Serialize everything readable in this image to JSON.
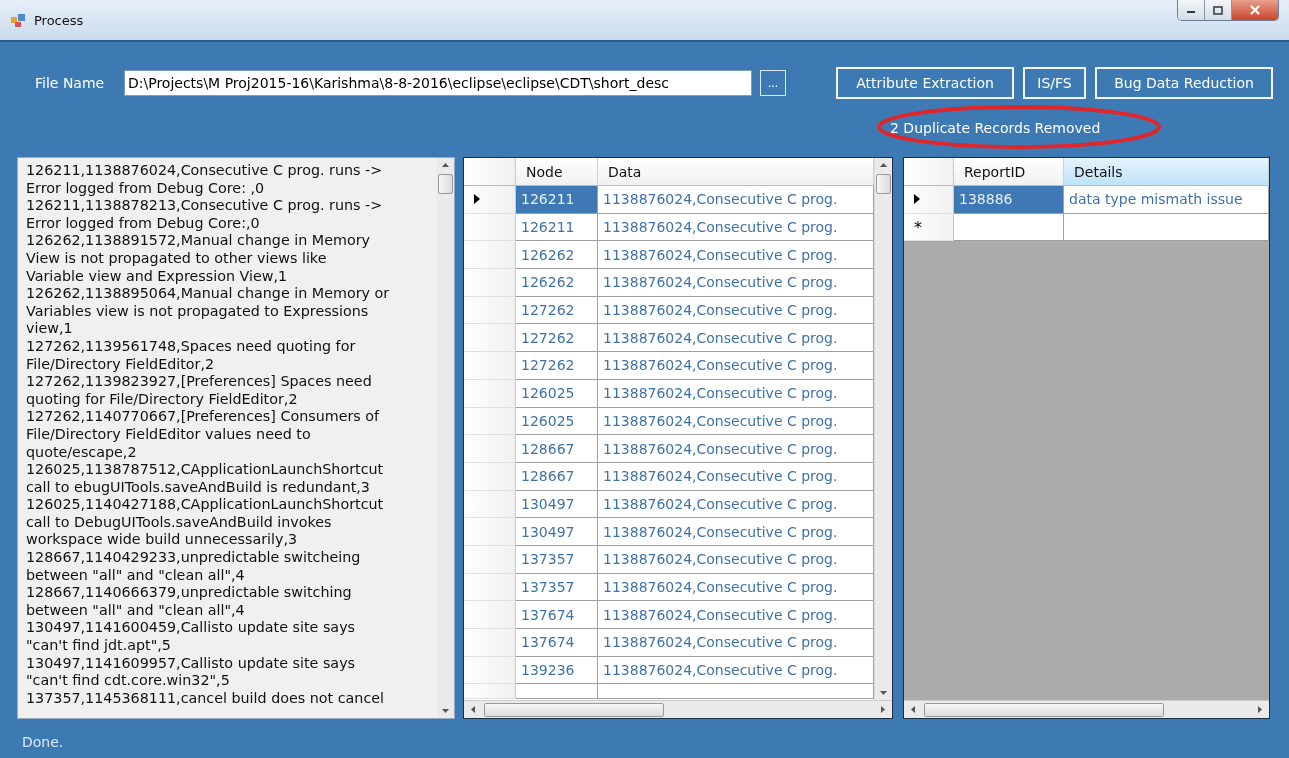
{
  "window": {
    "title": "Process"
  },
  "file_name": {
    "label": "File Name",
    "value": "D:\\Projects\\M Proj2015-16\\Karishma\\8-8-2016\\eclipse\\eclipse\\CDT\\short_desc"
  },
  "browse_button": "...",
  "buttons": [
    "Attribute Extraction",
    "IS/FS",
    "Bug Data Reduction"
  ],
  "result_message": "2 Duplicate Records Removed",
  "log_lines": [
    "126211,1138876024,Consecutive C prog. runs ->",
    "Error logged from Debug Core: ,0",
    "126211,1138878213,Consecutive C prog. runs ->",
    "Error logged from Debug Core:,0",
    "126262,1138891572,Manual change in Memory",
    "View is not propagated to other views like",
    "Variable view and Expression View,1",
    "126262,1138895064,Manual change in Memory or",
    "Variables view is not propagated to Expressions",
    "view,1",
    "127262,1139561748,Spaces need quoting for",
    "File/Directory FieldEditor,2",
    "127262,1139823927,[Preferences] Spaces need",
    "quoting for File/Directory FieldEditor,2",
    "127262,1140770667,[Preferences] Consumers of",
    "File/Directory FieldEditor values need to",
    "quote/escape,2",
    "126025,1138787512,CApplicationLaunchShortcut",
    "call to ebugUITools.saveAndBuild is redundant,3",
    "126025,1140427188,CApplicationLaunchShortcut",
    "call to DebugUITools.saveAndBuild invokes",
    "workspace wide build unnecessarily,3",
    "128667,1140429233,unpredictable switcheing",
    "between \"all\" and \"clean all\",4",
    "128667,1140666379,unpredictable switching",
    "between \"all\" and \"clean all\",4",
    "130497,1141600459,Callisto update site says",
    "\"can't find jdt.apt\",5",
    "130497,1141609957,Callisto update site says",
    "\"can't find cdt.core.win32\",5",
    "137357,1145368111,cancel build does not cancel"
  ],
  "nodes_grid": {
    "columns": [
      {
        "label": "Node",
        "highlighted": false
      },
      {
        "label": "Data",
        "highlighted": false
      }
    ],
    "rows": [
      {
        "node": "126211",
        "data": "1138876024,Consecutive C prog.",
        "selected": true
      },
      {
        "node": "126211",
        "data": "1138876024,Consecutive C prog.",
        "selected": false
      },
      {
        "node": "126262",
        "data": "1138876024,Consecutive C prog.",
        "selected": false
      },
      {
        "node": "126262",
        "data": "1138876024,Consecutive C prog.",
        "selected": false
      },
      {
        "node": "127262",
        "data": "1138876024,Consecutive C prog.",
        "selected": false
      },
      {
        "node": "127262",
        "data": "1138876024,Consecutive C prog.",
        "selected": false
      },
      {
        "node": "127262",
        "data": "1138876024,Consecutive C prog.",
        "selected": false
      },
      {
        "node": "126025",
        "data": "1138876024,Consecutive C prog.",
        "selected": false
      },
      {
        "node": "126025",
        "data": "1138876024,Consecutive C prog.",
        "selected": false
      },
      {
        "node": "128667",
        "data": "1138876024,Consecutive C prog.",
        "selected": false
      },
      {
        "node": "128667",
        "data": "1138876024,Consecutive C prog.",
        "selected": false
      },
      {
        "node": "130497",
        "data": "1138876024,Consecutive C prog.",
        "selected": false
      },
      {
        "node": "130497",
        "data": "1138876024,Consecutive C prog.",
        "selected": false
      },
      {
        "node": "137357",
        "data": "1138876024,Consecutive C prog.",
        "selected": false
      },
      {
        "node": "137357",
        "data": "1138876024,Consecutive C prog.",
        "selected": false
      },
      {
        "node": "137674",
        "data": "1138876024,Consecutive C prog.",
        "selected": false
      },
      {
        "node": "137674",
        "data": "1138876024,Consecutive C prog.",
        "selected": false
      },
      {
        "node": "139236",
        "data": "1138876024,Consecutive C prog.",
        "selected": false
      }
    ]
  },
  "reports_grid": {
    "columns": [
      {
        "label": "ReportID",
        "highlighted": false
      },
      {
        "label": "Details",
        "highlighted": true
      }
    ],
    "rows": [
      {
        "report_id": "138886",
        "details": "data type mismath issue",
        "selected": true
      }
    ],
    "new_row_marker": "*"
  },
  "status": "Done."
}
